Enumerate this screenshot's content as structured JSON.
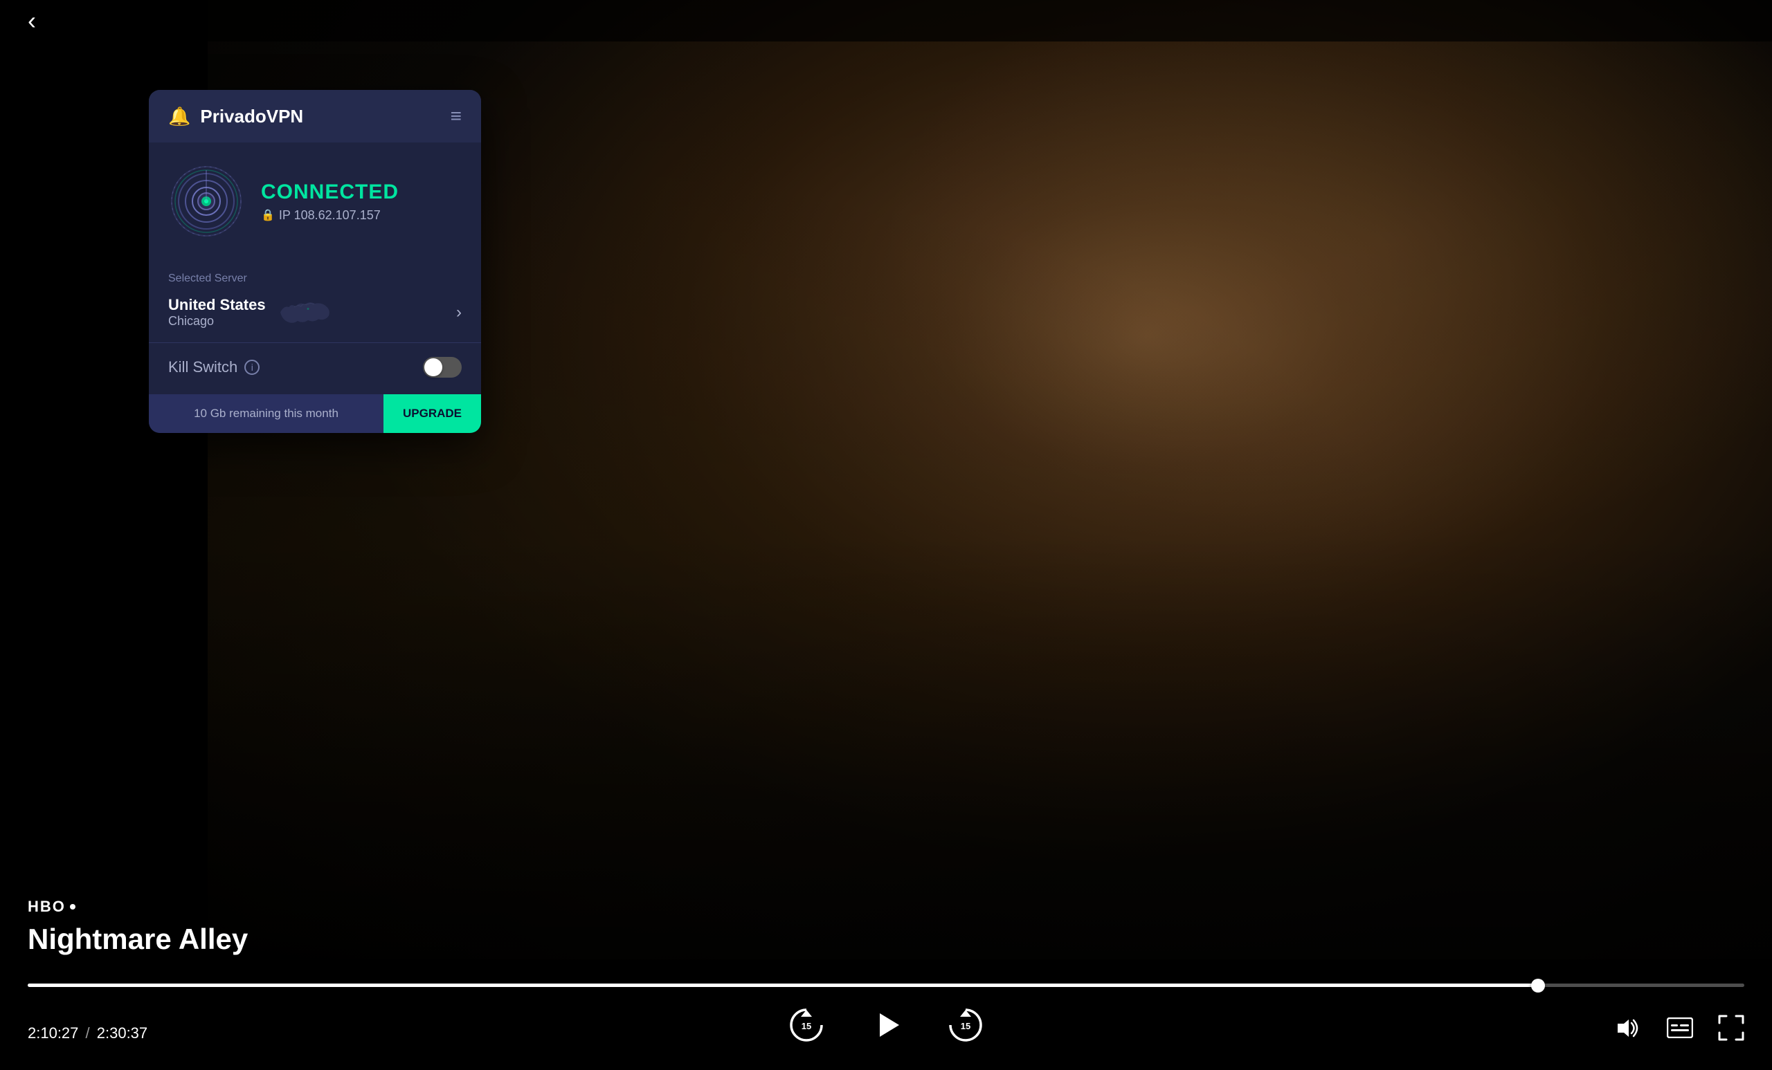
{
  "app": {
    "title": "PrivadoVPN",
    "back_label": "‹"
  },
  "vpn": {
    "header": {
      "title": "PrivadoVPN",
      "bell_icon": "🔔",
      "menu_icon": "≡"
    },
    "status": {
      "connected_text": "CONNECTED",
      "ip_label": "IP 108.62.107.157",
      "lock_icon": "🔒"
    },
    "server": {
      "label": "Selected Server",
      "country": "United States",
      "city": "Chicago"
    },
    "kill_switch": {
      "label": "Kill Switch",
      "info_icon": "i",
      "toggle_state": "off"
    },
    "footer": {
      "remaining_text": "10 Gb remaining this month",
      "upgrade_label": "UPGRADE"
    }
  },
  "player": {
    "network": "HBO",
    "show_title": "Nightmare Alley",
    "current_time": "2:10:27",
    "total_time": "2:30:37",
    "progress_percent": 88,
    "rewind_label": "⟲15",
    "forward_label": "15⟳"
  },
  "colors": {
    "connected_green": "#00e5a0",
    "panel_bg": "#1e2340",
    "panel_header": "#252b4e",
    "accent_green": "#00e5a0",
    "toggle_off": "#555555"
  }
}
